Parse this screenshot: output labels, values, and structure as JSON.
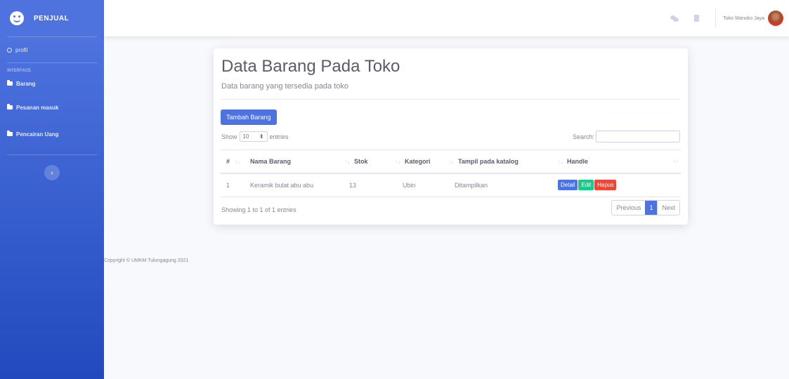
{
  "sidebar": {
    "brand": "PENJUAL",
    "profil": "profil",
    "heading": "INTERFACE",
    "items": [
      {
        "label": "Barang"
      },
      {
        "label": "Pesanan masuk"
      },
      {
        "label": "Pencairan Uang"
      }
    ],
    "toggle": "‹"
  },
  "topbar": {
    "username": "Toko Wanoko Jaya"
  },
  "card": {
    "title": "Data Barang Pada Toko",
    "subtitle": "Data barang yang tersedia pada toko",
    "add_button": "Tambah Barang",
    "show_label": "Show",
    "entries_value": "10",
    "entries_label": "entries",
    "search_label": "Search:",
    "search_value": ""
  },
  "table": {
    "headers": [
      "#",
      "Nama Barang",
      "Stok",
      "Kategori",
      "Tampil pada katalog",
      "Handle"
    ],
    "rows": [
      {
        "no": "1",
        "nama": "Keramik bulat abu abu",
        "stok": "13",
        "kategori": "Ubin",
        "tampil": "Ditampilkan"
      }
    ],
    "actions": {
      "detail": "Detail",
      "edit": "Edit",
      "hapus": "Hapus"
    }
  },
  "pagination": {
    "info": "Showing 1 to 1 of 1 entries",
    "previous": "Previous",
    "current": "1",
    "next": "Next"
  },
  "footer": "Copyright © UMKM Tulungagung 2021",
  "colors": {
    "primary": "#4e73df",
    "success": "#1cc88a",
    "danger": "#e74a3b"
  }
}
